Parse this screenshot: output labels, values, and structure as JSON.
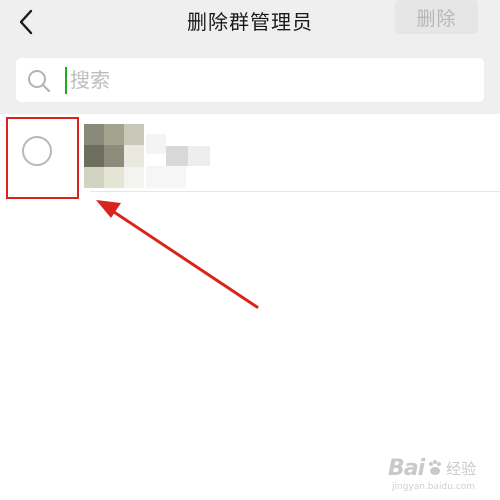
{
  "navbar": {
    "back_icon": "chevron-left-icon",
    "title": "删除群管理员",
    "delete_label": "删除"
  },
  "search": {
    "icon": "search-icon",
    "placeholder": "搜索",
    "value": ""
  },
  "members": [
    {
      "selected": false,
      "avatar": "pixelated-avatar",
      "name": ""
    }
  ],
  "annotation": {
    "box_color": "#d9231d",
    "arrow_color": "#d9231d"
  },
  "watermark": {
    "text_main": "Bai",
    "text_suffix": "经验",
    "url": "jingyan.baidu.com"
  },
  "colors": {
    "nav_bg": "#efefef",
    "caret": "#1aad19",
    "disabled_button_bg": "#e6e6e6",
    "disabled_button_text": "#b7b7b7"
  }
}
